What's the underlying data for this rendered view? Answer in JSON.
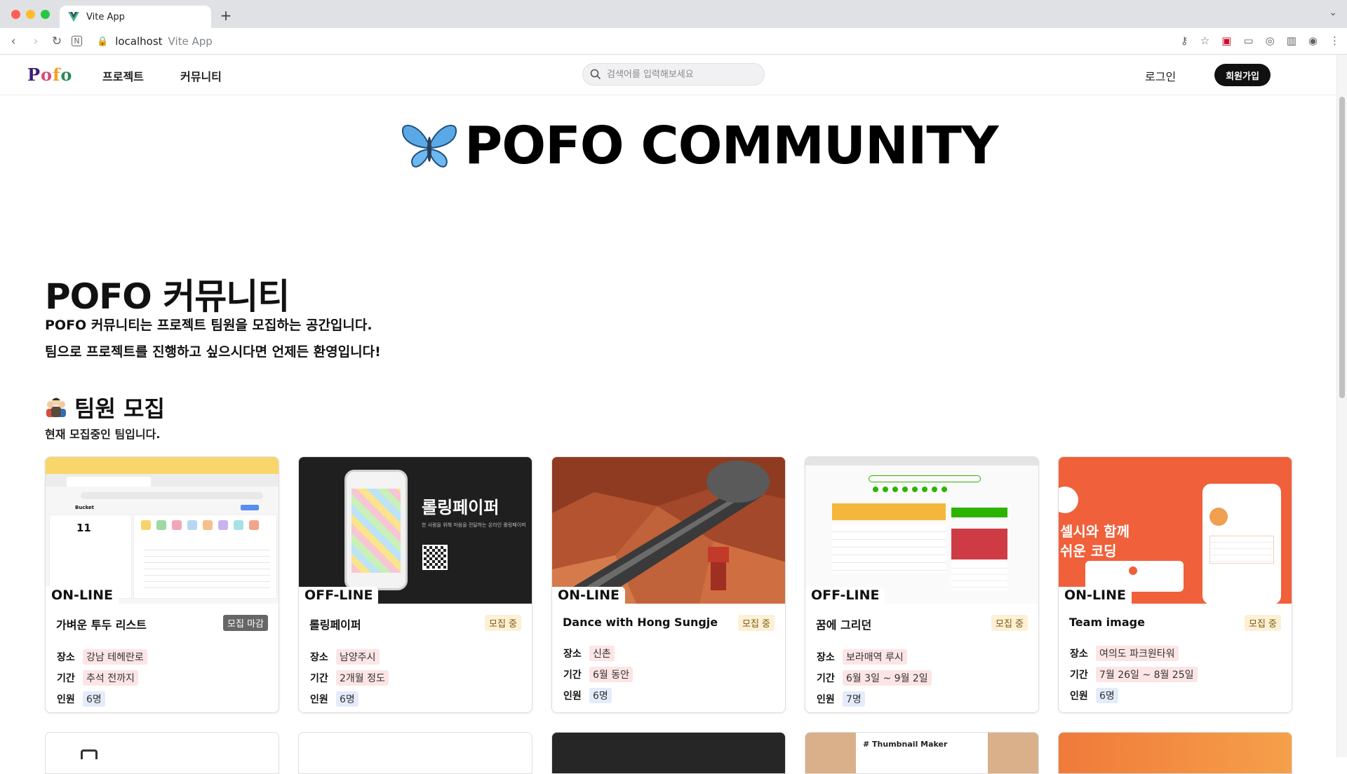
{
  "browser": {
    "tab_title": "Vite App",
    "new_tab": "+",
    "host": "localhost",
    "page_title": "Vite App"
  },
  "header": {
    "logo": "Pofo",
    "nav": [
      "프로젝트",
      "커뮤니티"
    ],
    "search_placeholder": "검색어를 입력해보세요",
    "login": "로그인",
    "signup": "회원가입"
  },
  "hero": {
    "title": "POFO COMMUNITY"
  },
  "section": {
    "title": "POFO 커뮤니티",
    "desc1": "POFO 커뮤니티는 프로젝트 팀원을 모집하는 공간입니다.",
    "desc2": "팀으로 프로젝트를 진행하고 싶으시다면 언제든 환영입니다!"
  },
  "recruit": {
    "title": "팀원 모집",
    "desc": "현재 모집중인 팀입니다."
  },
  "labels": {
    "place": "장소",
    "period": "기간",
    "people": "인원"
  },
  "cards": [
    {
      "mode": "ON-LINE",
      "name": "가벼운 투두 리스트",
      "status": "모집 마감",
      "place": "강남 테헤란로",
      "period": "추석 전까지",
      "people": "6명"
    },
    {
      "mode": "OFF-LINE",
      "name": "롤링페이퍼",
      "status": "모집 중",
      "place": "남양주시",
      "period": "2개월 정도",
      "people": "6명"
    },
    {
      "mode": "ON-LINE",
      "name": "Dance with Hong Sungje",
      "status": "모집 중",
      "place": "신촌",
      "period": "6월 동안",
      "people": "6명"
    },
    {
      "mode": "OFF-LINE",
      "name": "꿈에 그리던",
      "status": "모집 중",
      "place": "보라매역 루시",
      "period": "6월 3일 ~ 9월 2일",
      "people": "7명"
    },
    {
      "mode": "ON-LINE",
      "name": "Team image",
      "status": "모집 중",
      "place": "여의도 파크원타워",
      "period": "7월 26일 ~ 8월 25일",
      "people": "6명"
    }
  ],
  "thumb_text": {
    "todo_count": "11",
    "todo_app": "Bucket",
    "rolling_title": "롤링페이퍼",
    "rolling_sub": "한 사람을 위해 마음을 전달하는 온라인 롤링페이퍼",
    "orange_line1": "셀시와 함께",
    "orange_line2": "쉬운 코딩",
    "thumbnail_maker": "# Thumbnail Maker"
  },
  "colors": {
    "accent_dark": "#111111",
    "open_badge": "#fdf0d5",
    "closed_badge": "#666666",
    "tag_pink": "#fde5e5",
    "tag_blue": "#e4ecfb"
  }
}
